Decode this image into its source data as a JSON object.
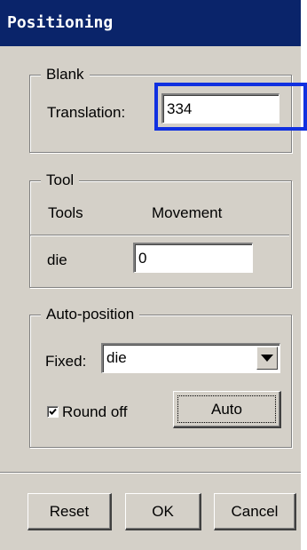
{
  "window": {
    "title": "Positioning"
  },
  "blank": {
    "legend": "Blank",
    "translation_label": "Translation:",
    "translation_value": "334"
  },
  "tool": {
    "legend": "Tool",
    "col_tools": "Tools",
    "col_movement": "Movement",
    "rows": [
      {
        "tool": "die",
        "movement": "0"
      }
    ]
  },
  "auto_position": {
    "legend": "Auto-position",
    "fixed_label": "Fixed:",
    "fixed_value": "die",
    "round_off_label": "Round off",
    "round_off_checked": true,
    "auto_button": "Auto"
  },
  "buttons": {
    "reset": "Reset",
    "ok": "OK",
    "cancel": "Cancel"
  },
  "colors": {
    "title_bar": "#0a246a",
    "panel": "#d4d0c8",
    "highlight": "#1030e0"
  }
}
